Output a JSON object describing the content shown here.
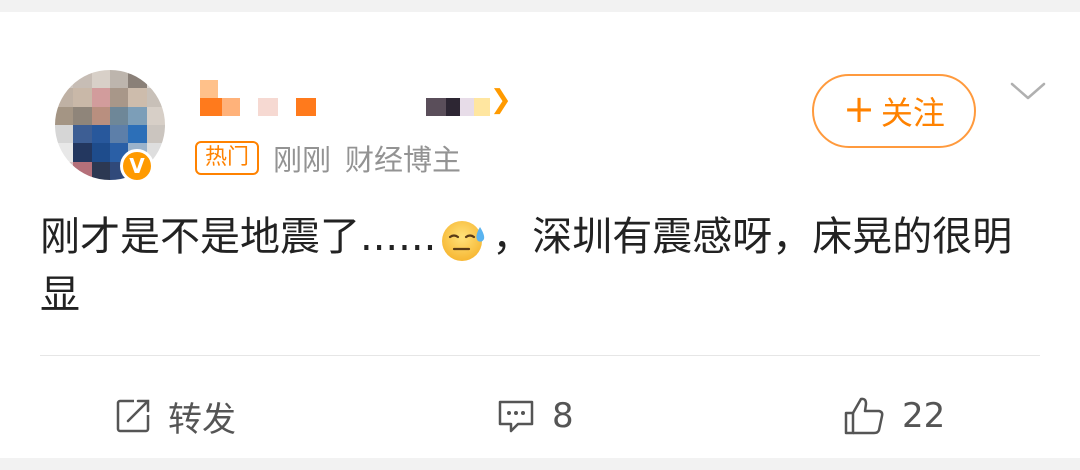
{
  "post": {
    "author": {
      "avatar_badge": "V",
      "name_suffix_icon": "chevron-right-icon"
    },
    "meta": {
      "hot_label": "热门",
      "time": "刚刚",
      "tag": "财经博主"
    },
    "follow_label": "关注",
    "follow_plus": "+",
    "content_part1": "刚才是不是地震了......",
    "content_emoji": "sweat-emoji",
    "content_part2": "，深圳有震感呀，床晃的很明显"
  },
  "actions": {
    "repost_label": "转发",
    "comment_count": "8",
    "like_count": "22"
  },
  "colors": {
    "accent": "#ff8200",
    "muted_text": "#939393",
    "background": "#f2f2f2"
  }
}
